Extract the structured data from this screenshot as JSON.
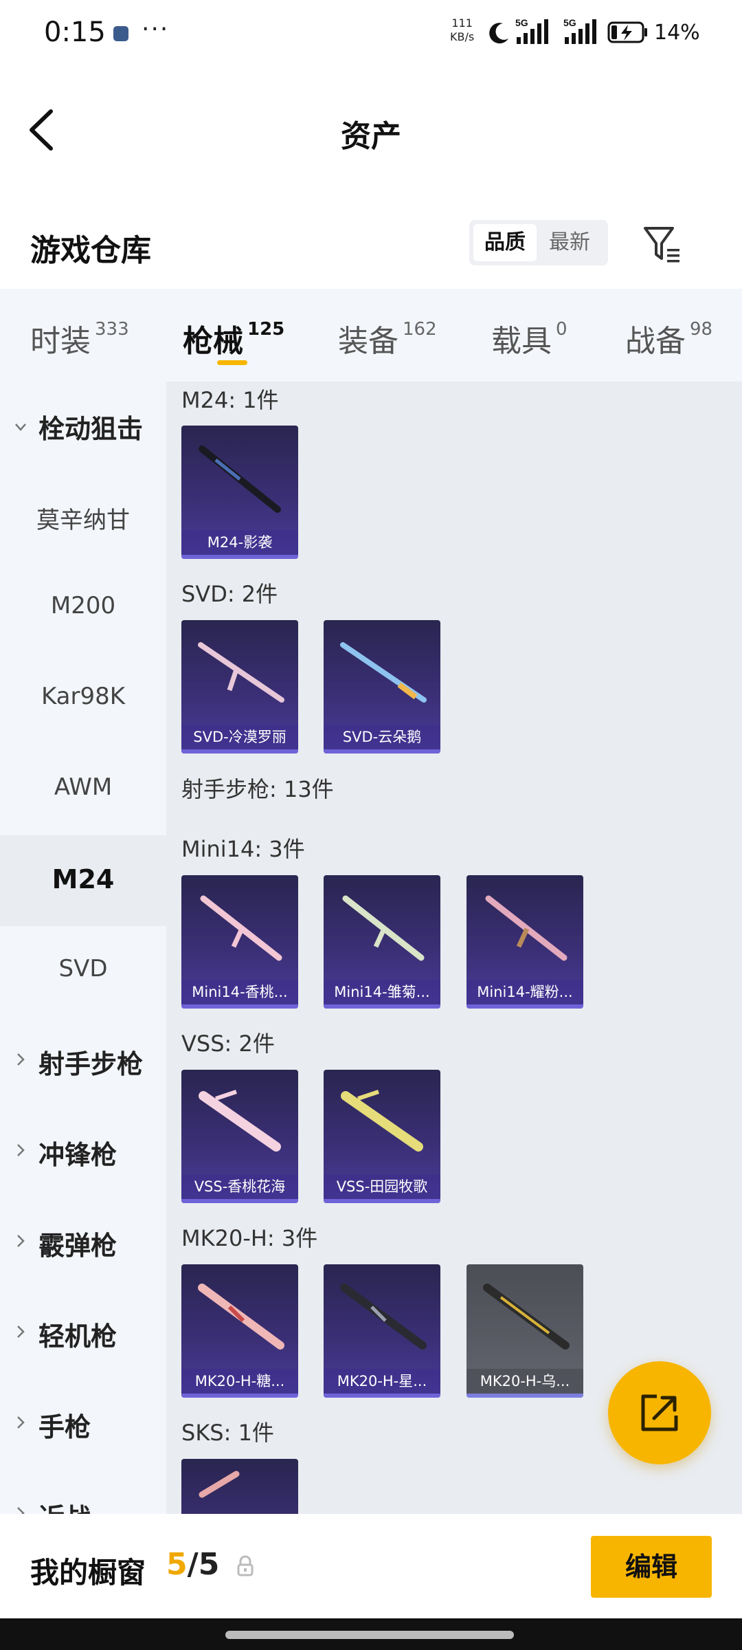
{
  "status": {
    "time": "0:15",
    "speed_value": "111",
    "speed_unit": "KB/s",
    "network1": "5G",
    "network2": "5G",
    "battery": "14%"
  },
  "header": {
    "title": "资产"
  },
  "warehouse": {
    "title": "游戏仓库",
    "sort_quality": "品质",
    "sort_newest": "最新"
  },
  "tabs": [
    {
      "label": "时装",
      "count": "333"
    },
    {
      "label": "枪械",
      "count": "125"
    },
    {
      "label": "装备",
      "count": "162"
    },
    {
      "label": "载具",
      "count": "0"
    },
    {
      "label": "战备",
      "count": "98"
    }
  ],
  "sidebar": {
    "open_group": "栓动狙击",
    "sub_items": [
      "莫辛纳甘",
      "M200",
      "Kar98K",
      "AWM",
      "M24",
      "SVD"
    ],
    "selected": "M24",
    "groups": [
      "射手步枪",
      "冲锋枪",
      "霰弹枪",
      "轻机枪",
      "手枪",
      "近战"
    ]
  },
  "content": {
    "sections": [
      {
        "header": "M24: 1件",
        "items": [
          "M24-影袭"
        ]
      },
      {
        "header": "SVD: 2件",
        "items": [
          "SVD-冷漠罗丽",
          "SVD-云朵鹅"
        ]
      },
      {
        "header": "射手步枪: 13件",
        "items": []
      },
      {
        "header": "Mini14: 3件",
        "items": [
          "Mini14-香桃...",
          "Mini14-雏菊...",
          "Mini14-耀粉..."
        ]
      },
      {
        "header": "VSS: 2件",
        "items": [
          "VSS-香桃花海",
          "VSS-田园牧歌"
        ]
      },
      {
        "header": "MK20-H: 3件",
        "items": [
          "MK20-H-糖...",
          "MK20-H-星...",
          "MK20-H-乌..."
        ]
      },
      {
        "header": "SKS: 1件",
        "items": [
          ""
        ]
      }
    ]
  },
  "showcase": {
    "label": "我的橱窗",
    "current": "5",
    "sep": "/",
    "max": "5",
    "edit_label": "编辑"
  },
  "colors": {
    "accent": "#f7b500",
    "card_purple": "#3a2f75",
    "card_grey": "#5a5c65"
  }
}
